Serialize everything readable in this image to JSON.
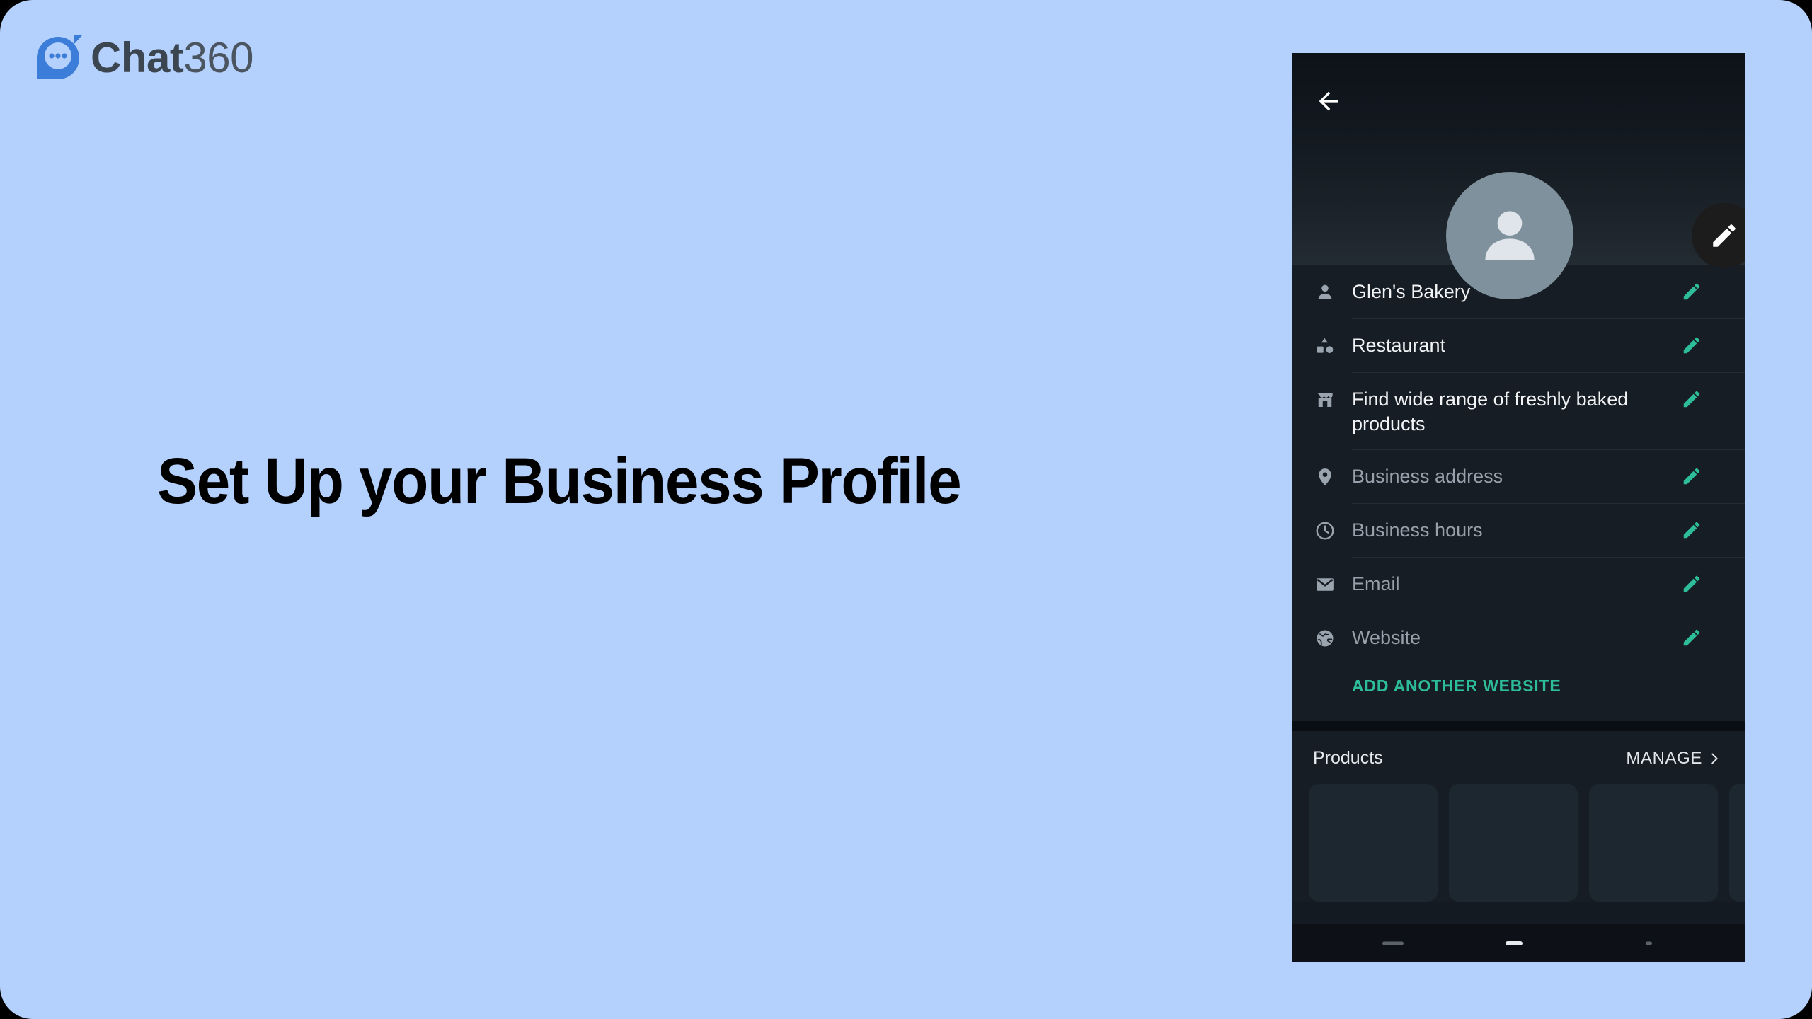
{
  "brand": {
    "name_strong": "Chat",
    "name_light": "360",
    "logo_icon": "chat-bubble-logo-icon"
  },
  "headline": {
    "text": "Set Up your Business Profile"
  },
  "phone": {
    "header": {
      "back_icon": "back-arrow-icon",
      "avatar_icon": "person-avatar-icon",
      "edit_cover_icon": "pencil-edit-icon"
    },
    "info_rows": [
      {
        "icon": "person-icon",
        "text": "Glen's Bakery",
        "is_placeholder": false,
        "edit_icon": "pencil-edit-icon"
      },
      {
        "icon": "category-shapes-icon",
        "text": "Restaurant",
        "is_placeholder": false,
        "edit_icon": "pencil-edit-icon"
      },
      {
        "icon": "storefront-icon",
        "text": "Find wide range of freshly baked products",
        "is_placeholder": false,
        "edit_icon": "pencil-edit-icon"
      },
      {
        "icon": "location-pin-icon",
        "text": "Business address",
        "is_placeholder": true,
        "edit_icon": "pencil-edit-icon"
      },
      {
        "icon": "clock-icon",
        "text": "Business hours",
        "is_placeholder": true,
        "edit_icon": "pencil-edit-icon"
      },
      {
        "icon": "email-envelope-icon",
        "text": "Email",
        "is_placeholder": true,
        "edit_icon": "pencil-edit-icon"
      },
      {
        "icon": "globe-website-icon",
        "text": "Website",
        "is_placeholder": true,
        "edit_icon": "pencil-edit-icon"
      }
    ],
    "add_another_website_label": "ADD ANOTHER WEBSITE",
    "products": {
      "title": "Products",
      "manage_label": "MANAGE",
      "manage_chevron_icon": "chevron-right-icon",
      "cards_count": 3
    },
    "nav_bar": {
      "recent_icon": "recent-apps-icon",
      "home_icon": "home-indicator-icon",
      "back_icon": "nav-back-icon"
    }
  },
  "colors": {
    "slide_background": "#b4d0fc",
    "brand_text": "#3c4650",
    "logo_blue": "#3b7dd8",
    "headline": "#000000",
    "phone_surface": "#171d25",
    "accent_green": "#2dbd9a",
    "placeholder_text": "#98a1ab",
    "avatar_fill": "#7f919c"
  }
}
